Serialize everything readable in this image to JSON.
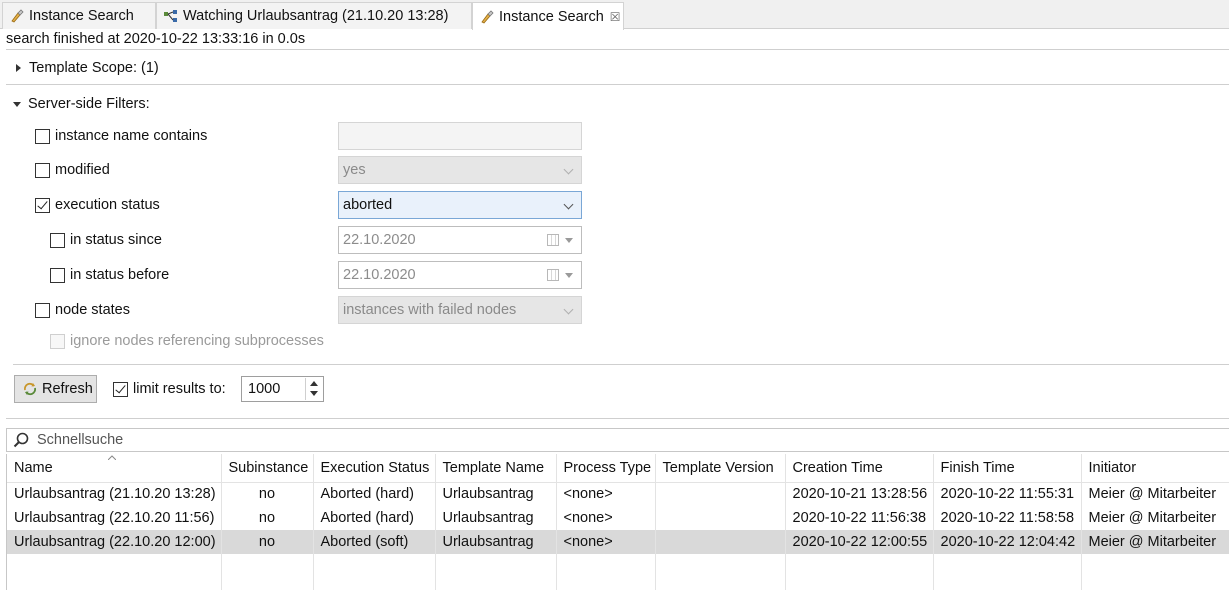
{
  "tabs": [
    {
      "label": "Instance Search",
      "icon": "instance-search-icon",
      "active": false
    },
    {
      "label": "Watching Urlaubsantrag (21.10.20 13:28)",
      "icon": "process-watch-icon",
      "active": false
    },
    {
      "label": "Instance Search",
      "icon": "instance-search-icon",
      "active": true,
      "close": "☒"
    }
  ],
  "status_text": "search finished at 2020-10-22 13:33:16 in 0.0s",
  "template_scope": {
    "label": "Template Scope: (1)",
    "expanded": false
  },
  "server_filters": {
    "label": "Server-side Filters:",
    "expanded": true,
    "instance_name": {
      "label": "instance name contains",
      "checked": false,
      "value": ""
    },
    "modified": {
      "label": "modified",
      "checked": false,
      "value": "yes"
    },
    "execution_status": {
      "label": "execution status",
      "checked": true,
      "value": "aborted"
    },
    "status_since": {
      "label": "in status since",
      "checked": false,
      "value": "22.10.2020"
    },
    "status_before": {
      "label": "in status before",
      "checked": false,
      "value": "22.10.2020"
    },
    "node_states": {
      "label": "node states",
      "checked": false,
      "value": "instances with failed nodes"
    },
    "ignore_nodes": {
      "label": "ignore nodes referencing subprocesses",
      "checked": false
    }
  },
  "refresh_label": "Refresh",
  "limit": {
    "label": "limit results to:",
    "checked": true,
    "value": "1000"
  },
  "search": {
    "placeholder": "Schnellsuche"
  },
  "table": {
    "columns": [
      "Name",
      "Subinstance",
      "Execution Status",
      "Template Name",
      "Process Type",
      "Template Version",
      "Creation Time",
      "Finish Time",
      "Initiator"
    ],
    "sort_column": "Name",
    "rows": [
      [
        "Urlaubsantrag (21.10.20 13:28)",
        "no",
        "Aborted (hard)",
        "Urlaubsantrag",
        "<none>",
        "",
        "2020-10-21 13:28:56",
        "2020-10-22 11:55:31",
        "Meier @ Mitarbeiter"
      ],
      [
        "Urlaubsantrag (22.10.20 11:56)",
        "no",
        "Aborted (hard)",
        "Urlaubsantrag",
        "<none>",
        "",
        "2020-10-22 11:56:38",
        "2020-10-22 11:58:58",
        "Meier @ Mitarbeiter"
      ],
      [
        "Urlaubsantrag (22.10.20 12:00)",
        "no",
        "Aborted (soft)",
        "Urlaubsantrag",
        "<none>",
        "",
        "2020-10-22 12:00:55",
        "2020-10-22 12:04:42",
        "Meier @ Mitarbeiter"
      ]
    ],
    "selected_row": 2
  },
  "colors": {
    "accent": "#7aa7d6",
    "selection": "#d9d9d9"
  }
}
